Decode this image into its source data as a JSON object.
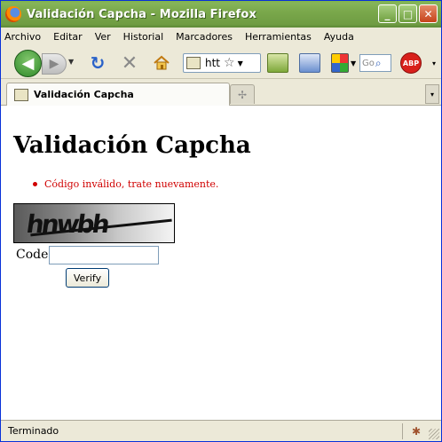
{
  "window": {
    "title": "Validación Capcha - Mozilla Firefox",
    "buttons": {
      "minimize": "_",
      "maximize": "□",
      "close": "✕"
    }
  },
  "menubar": {
    "items": [
      {
        "label": "Archivo"
      },
      {
        "label": "Editar"
      },
      {
        "label": "Ver"
      },
      {
        "label": "Historial"
      },
      {
        "label": "Marcadores"
      },
      {
        "label": "Herramientas"
      },
      {
        "label": "Ayuda"
      }
    ]
  },
  "toolbar": {
    "url_text": "htt",
    "search_placeholder": "Go",
    "abp_label": "ABP",
    "icons": [
      "back-icon",
      "forward-icon",
      "reload-icon",
      "stop-icon",
      "home-icon",
      "bookmark-star-icon",
      "addon-icon",
      "download-icon",
      "google-icon",
      "search-icon",
      "adblock-icon"
    ]
  },
  "tabs": [
    {
      "label": "Validación Capcha",
      "active": true
    }
  ],
  "page": {
    "heading": "Validación Capcha",
    "error_message": "Código inválido, trate nuevamente.",
    "captcha_text": "hnwbh",
    "code_label": "Code:",
    "code_value": "",
    "verify_label": "Verify"
  },
  "statusbar": {
    "text": "Terminado"
  },
  "colors": {
    "titlebar": "#7aa84b",
    "error": "#d00000",
    "chrome": "#ece9d8"
  }
}
